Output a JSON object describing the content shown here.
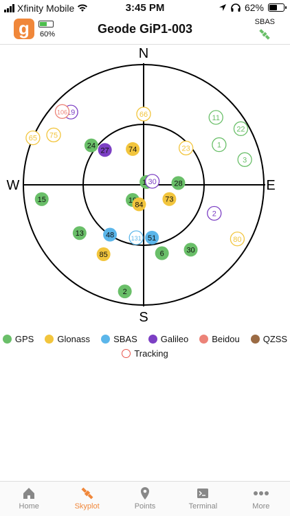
{
  "status": {
    "carrier": "Xfinity Mobile",
    "time": "3:45 PM",
    "battery": "62%",
    "battery_level": 0.62
  },
  "header": {
    "device_battery": "60%",
    "device_battery_level": 0.6,
    "title": "Geode GiP1-003",
    "sbas_label": "SBAS",
    "logo_letter": "g"
  },
  "compass": {
    "n": "N",
    "s": "S",
    "e": "E",
    "w": "W"
  },
  "colors": {
    "gps": "#6abf69",
    "glonass": "#f2c53d",
    "sbas": "#5bb6ea",
    "galileo": "#7c3fc4",
    "beidou": "#ec8378",
    "qzss": "#9b6b44",
    "accent": "#f0873a"
  },
  "satellites": [
    {
      "id": "66",
      "type": "glonass",
      "az": 0,
      "el": 37,
      "tracking": false
    },
    {
      "id": "19",
      "type": "galileo",
      "az": 315,
      "el": 13,
      "tracking": false
    },
    {
      "id": "106",
      "type": "beidou",
      "az": 312,
      "el": 8,
      "tracking": false
    },
    {
      "id": "75",
      "type": "glonass",
      "az": 299,
      "el": 13,
      "tracking": false
    },
    {
      "id": "65",
      "type": "glonass",
      "az": 293,
      "el": 0,
      "tracking": false
    },
    {
      "id": "11",
      "type": "gps",
      "az": 47,
      "el": 16,
      "tracking": false
    },
    {
      "id": "1",
      "type": "gps",
      "az": 62,
      "el": 26,
      "tracking": false
    },
    {
      "id": "22",
      "type": "gps",
      "az": 60,
      "el": 6,
      "tracking": false
    },
    {
      "id": "23",
      "type": "glonass",
      "az": 49,
      "el": 48,
      "tracking": false
    },
    {
      "id": "3",
      "type": "gps",
      "az": 76,
      "el": 12,
      "tracking": false
    },
    {
      "id": "24",
      "type": "gps",
      "az": 307,
      "el": 41,
      "tracking": true
    },
    {
      "id": "27",
      "type": "galileo",
      "az": 312,
      "el": 51,
      "tracking": true
    },
    {
      "id": "74",
      "type": "glonass",
      "az": 343,
      "el": 62,
      "tracking": true
    },
    {
      "id": "17",
      "type": "gps",
      "az": 45,
      "el": 87,
      "tracking": true
    },
    {
      "id": "30",
      "type": "galileo",
      "az": 68,
      "el": 83,
      "tracking": false
    },
    {
      "id": "28",
      "type": "gps",
      "az": 87,
      "el": 64,
      "tracking": true
    },
    {
      "id": "15",
      "type": "gps",
      "az": 262,
      "el": 13,
      "tracking": true
    },
    {
      "id": "19",
      "type": "gps",
      "az": 216,
      "el": 76,
      "tracking": true
    },
    {
      "id": "84",
      "type": "glonass",
      "az": 193,
      "el": 75,
      "tracking": true
    },
    {
      "id": "73",
      "type": "glonass",
      "az": 119,
      "el": 68,
      "tracking": true
    },
    {
      "id": "2",
      "type": "galileo",
      "az": 112,
      "el": 33,
      "tracking": false
    },
    {
      "id": "13",
      "type": "gps",
      "az": 233,
      "el": 30,
      "tracking": true
    },
    {
      "id": "48",
      "type": "sbas",
      "az": 214,
      "el": 45,
      "tracking": true
    },
    {
      "id": "131",
      "type": "sbas",
      "az": 188,
      "el": 50,
      "tracking": false
    },
    {
      "id": "51",
      "type": "sbas",
      "az": 171,
      "el": 50,
      "tracking": true
    },
    {
      "id": "6",
      "type": "gps",
      "az": 165,
      "el": 37,
      "tracking": true
    },
    {
      "id": "30",
      "type": "gps",
      "az": 144,
      "el": 30,
      "tracking": true
    },
    {
      "id": "80",
      "type": "glonass",
      "az": 120,
      "el": 9,
      "tracking": false
    },
    {
      "id": "85",
      "type": "glonass",
      "az": 210,
      "el": 30,
      "tracking": true
    },
    {
      "id": "2",
      "type": "gps",
      "az": 190,
      "el": 9,
      "tracking": true
    }
  ],
  "legend": [
    {
      "label": "GPS",
      "color": "#6abf69"
    },
    {
      "label": "Glonass",
      "color": "#f2c53d"
    },
    {
      "label": "SBAS",
      "color": "#5bb6ea"
    },
    {
      "label": "Galileo",
      "color": "#7c3fc4"
    },
    {
      "label": "Beidou",
      "color": "#ec8378"
    },
    {
      "label": "QZSS",
      "color": "#9b6b44"
    }
  ],
  "legend_tracking": "Tracking",
  "tabs": [
    {
      "label": "Home",
      "icon": "home-icon",
      "active": false
    },
    {
      "label": "Skyplot",
      "icon": "satellite-icon",
      "active": true
    },
    {
      "label": "Points",
      "icon": "map-pin-icon",
      "active": false
    },
    {
      "label": "Terminal",
      "icon": "terminal-icon",
      "active": false
    },
    {
      "label": "More",
      "icon": "more-icon",
      "active": false
    }
  ]
}
